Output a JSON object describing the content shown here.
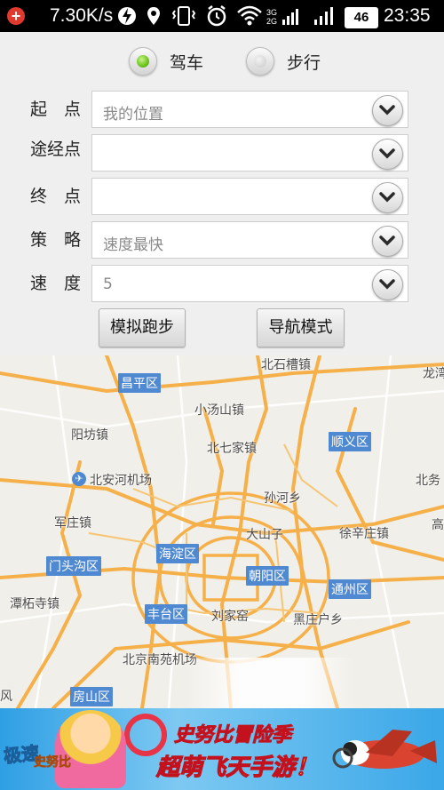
{
  "status_bar": {
    "speed": "7.30K/s",
    "network_3g": "3G",
    "network_2g": "2G",
    "battery": "46",
    "time": "23:35",
    "icons": [
      "notification-add-icon",
      "lightning-icon",
      "location-icon",
      "vibrate-icon",
      "alarm-icon",
      "wifi-icon",
      "signal-icon",
      "battery-icon"
    ]
  },
  "mode": {
    "drive_label": "驾车",
    "walk_label": "步行",
    "selected": "drive"
  },
  "form": {
    "start_label": "起　点",
    "start_value": "我的位置",
    "via_label": "途经点",
    "via_value": "",
    "end_label": "终　点",
    "end_value": "",
    "strategy_label": "策　略",
    "strategy_value": "速度最快",
    "speed_label": "速　度",
    "speed_value": "5"
  },
  "buttons": {
    "simulate_run": "模拟跑步",
    "navigation_mode": "导航模式"
  },
  "map": {
    "places": {
      "beishicao": "北石槽镇",
      "longwan": "龙湾",
      "xiaotangshan": "小汤山镇",
      "yangfang": "阳坊镇",
      "beiqijia": "北七家镇",
      "beianhe_airport": "北安河机场",
      "sunhe": "孙河乡",
      "beiwu": "北务",
      "junzhuang": "军庄镇",
      "dashanzi": "大山子",
      "xinzhuang": "徐辛庄镇",
      "gao": "高",
      "tanzhesi": "潭柘寺镇",
      "liujiayao": "刘家窑",
      "heizhuanghu": "黑庄户乡",
      "beijing_south": "北京南苑机场",
      "feng": "风"
    },
    "districts": {
      "changping": "昌平区",
      "shunyi": "顺义区",
      "haidian": "海淀区",
      "mentougou": "门头沟区",
      "chaoyang": "朝阳区",
      "tongzhou": "通州区",
      "fengtai": "丰台区",
      "fangshan": "房山区"
    },
    "colors": {
      "road": "#f5b04a",
      "district_tag": "#4f89d1",
      "background": "#f1efe9"
    }
  },
  "ad": {
    "logo_line1": "极速",
    "logo_line2": "史努比",
    "slogan_line1": "史努比冒险季",
    "slogan_line2": "超萌飞天手游！"
  }
}
